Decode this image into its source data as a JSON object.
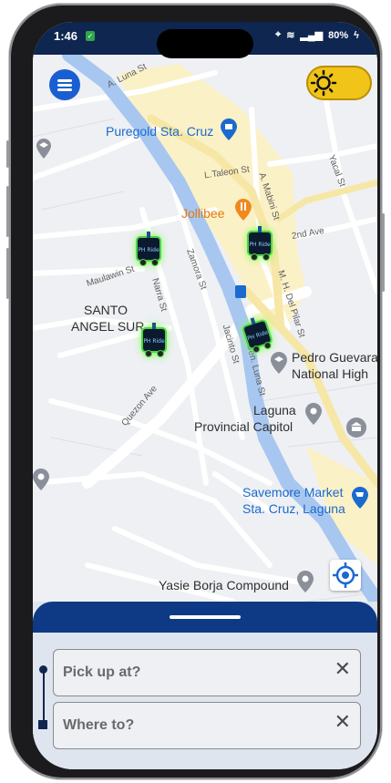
{
  "status": {
    "time": "1:46",
    "battery": "80%"
  },
  "map": {
    "labels": {
      "puregold": "Puregold Sta. Cruz",
      "jollibee": "Jollibee",
      "santo_angel_1": "SANTO",
      "santo_angel_2": "ANGEL SUR",
      "pedro_1": "Pedro Guevara",
      "pedro_2": "National High",
      "capitol_1": "Laguna",
      "capitol_2": "Provincial Capitol",
      "savemore_1": "Savemore Market",
      "savemore_2": "Sta. Cruz, Laguna",
      "yasie": "Yasie Borja Compound"
    },
    "streets": {
      "luna": "A. Luna St",
      "taleon": "L.Taleon St",
      "yacal": "Yacal St",
      "mabini": "A. Mabini St",
      "second_ave": "2nd Ave",
      "maulawin": "Maulawin St",
      "narra": "Narra St",
      "zamora": "Zamora St",
      "mh_del_pilar": "M. H. Del Pilar St",
      "jacinto": "Jacinto St",
      "gen_luna": "Gen. Luna St",
      "quezon": "Quezon Ave"
    },
    "vehicle_brand": "PH Ride"
  },
  "search": {
    "pickup_placeholder": "Pick up at?",
    "destination_placeholder": "Where to?"
  },
  "colors": {
    "accent": "#0e3a85",
    "toggle": "#f0c419",
    "river": "#a8c7f0",
    "road_major": "#f6e7a6"
  }
}
